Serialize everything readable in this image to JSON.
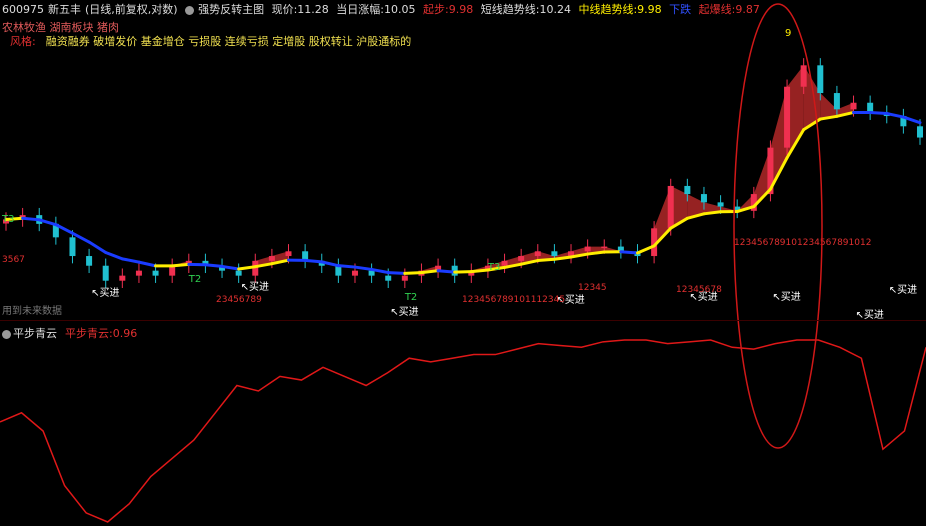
{
  "header": {
    "code": "600975",
    "name": "新五丰",
    "mode": "(日线,前复权,对数)",
    "indicator_name": "强势反转主图",
    "price_label": "现价:",
    "price": "11.28",
    "change_label": "当日涨幅:",
    "change": "10.05",
    "start_label": "起步:",
    "start": "9.98",
    "short_label": "短线趋势线:",
    "short": "10.24",
    "mid_label": "中线趋势线:",
    "mid": "9.98",
    "fall_label": "下跌",
    "rise_label": "起爆线:",
    "rise": "9.87"
  },
  "tags": {
    "sectors": "农林牧渔 湖南板块 猪肉",
    "style_label": "风格:",
    "styles": "融资融券 破增发价 基金增仓 亏损股 连续亏损 定增股 股权转让 沪股通标的"
  },
  "hint": "用到未来数据",
  "sub": {
    "name": "平步青云",
    "value_label": "平步青云:",
    "value": "0.96"
  },
  "labels": {
    "buy": "买进",
    "t2": "T2",
    "t3": "T3",
    "nine": "9"
  },
  "colors": {
    "up": "#f03050",
    "down": "#20c0d0",
    "trend_up": "#ffee00",
    "trend_down": "#1a3cff",
    "ribbon": "#b02828",
    "subline": "#e01818",
    "circle": "#d01818"
  },
  "counts": {
    "a": "3567",
    "b": "23456789",
    "c": "123456789101112345",
    "d": "12345",
    "e": "12345678",
    "f": "123456789101234567891012"
  },
  "chart_data": {
    "type": "line",
    "price_closes": [
      9.2,
      9.3,
      9.1,
      8.8,
      8.4,
      8.2,
      7.9,
      8.0,
      8.1,
      8.0,
      8.2,
      8.3,
      8.2,
      8.1,
      8.0,
      8.3,
      8.4,
      8.5,
      8.3,
      8.2,
      8.0,
      8.1,
      8.0,
      7.9,
      8.0,
      8.1,
      8.2,
      8.0,
      8.1,
      8.2,
      8.3,
      8.4,
      8.5,
      8.4,
      8.5,
      8.6,
      8.6,
      8.5,
      8.4,
      9.0,
      10.0,
      9.8,
      9.6,
      9.5,
      9.4,
      9.8,
      11.0,
      12.8,
      13.5,
      12.6,
      12.1,
      12.3,
      12.0,
      11.9,
      11.6,
      11.28
    ],
    "sub_series": {
      "name": "平步青云",
      "values": [
        0.55,
        0.6,
        0.5,
        0.2,
        0.05,
        0.0,
        0.1,
        0.25,
        0.35,
        0.45,
        0.6,
        0.75,
        0.72,
        0.8,
        0.78,
        0.85,
        0.8,
        0.75,
        0.82,
        0.9,
        0.88,
        0.9,
        0.92,
        0.92,
        0.95,
        0.98,
        0.97,
        0.96,
        0.99,
        1.0,
        1.0,
        0.98,
        0.99,
        1.0,
        0.96,
        0.95,
        0.98,
        1.0,
        1.0,
        0.96,
        0.9,
        0.4,
        0.5,
        0.96
      ]
    }
  }
}
